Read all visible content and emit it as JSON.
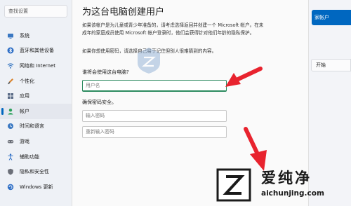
{
  "sidebar": {
    "search_placeholder": "查找设置",
    "items": [
      {
        "label": "系统",
        "icon": "monitor-icon",
        "active": false
      },
      {
        "label": "蓝牙和其他设备",
        "icon": "bluetooth-icon",
        "active": false
      },
      {
        "label": "网络和 Internet",
        "icon": "network-icon",
        "active": false
      },
      {
        "label": "个性化",
        "icon": "brush-icon",
        "active": false
      },
      {
        "label": "应用",
        "icon": "apps-icon",
        "active": false
      },
      {
        "label": "帐户",
        "icon": "account-icon",
        "active": true
      },
      {
        "label": "时间和语言",
        "icon": "clock-globe-icon",
        "active": false
      },
      {
        "label": "游戏",
        "icon": "gamepad-icon",
        "active": false
      },
      {
        "label": "辅助功能",
        "icon": "accessibility-icon",
        "active": false
      },
      {
        "label": "隐私和安全性",
        "icon": "shield-icon",
        "active": false
      },
      {
        "label": "Windows 更新",
        "icon": "update-icon",
        "active": false
      }
    ]
  },
  "right_panel": {
    "add_account_label": "家帐户",
    "start_label": "开始"
  },
  "dialog": {
    "title": "为这台电脑创建用户",
    "intro_line1": "如果该帐户是为儿童或青少年准备的，请考虑选择返回并创建一个 Microsoft 帐户。在未",
    "intro_line2": "成年的家庭成员使用 Microsoft 帐户登录时，他们会获得针对他们年龄的隐私保护。",
    "password_hint": "如果你想使用密码，请选择自己易于记住但别人很难猜到的内容。",
    "who_label": "谁将会使用这台电脑?",
    "username_placeholder": "用户名",
    "security_label": "确保密码安全。",
    "password_placeholder": "输入密码",
    "repassword_placeholder": "重新输入密码"
  },
  "watermark": {
    "brand": "爱纯净",
    "url": "aichunjing.com"
  },
  "colors": {
    "accent": "#0067c0",
    "arrow": "#e8232e",
    "focus": "#2b8a5e"
  }
}
